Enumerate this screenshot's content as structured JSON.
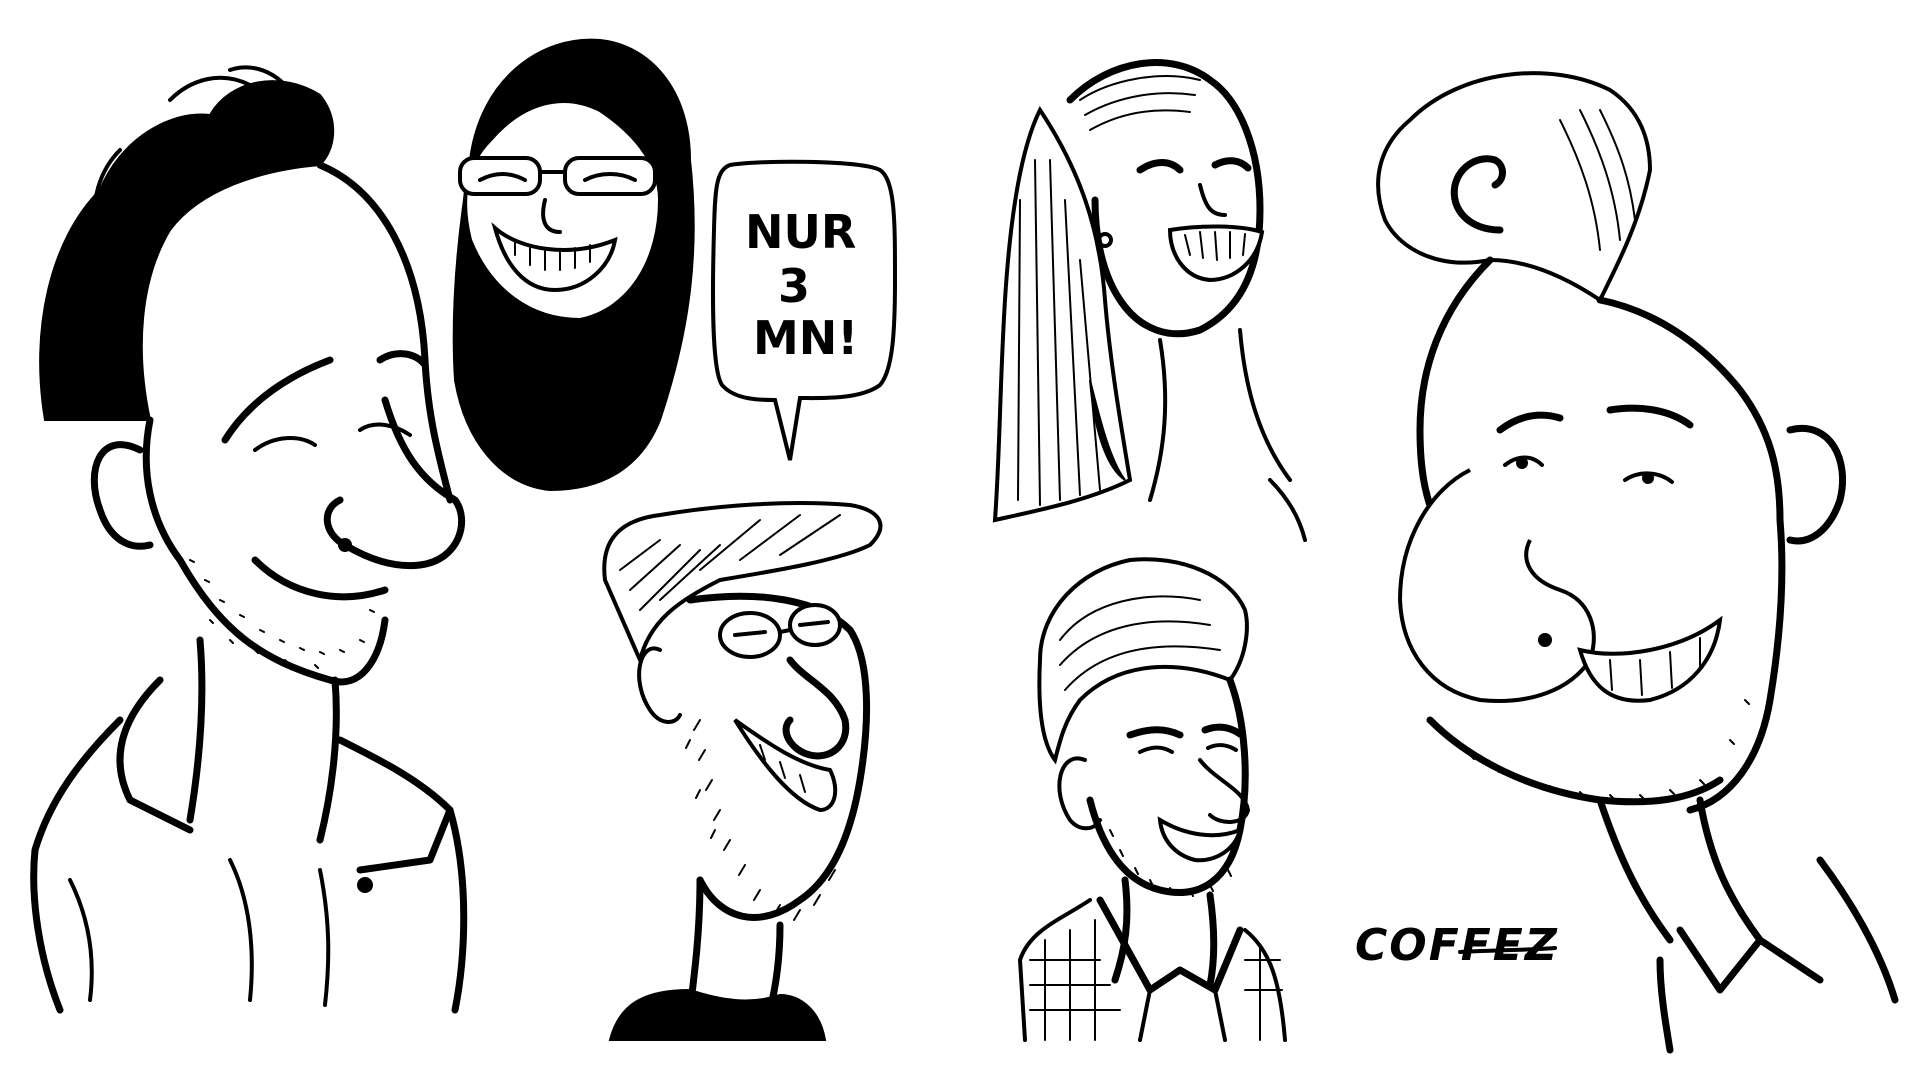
{
  "speech_bubble": {
    "lines": [
      "NUR",
      "3",
      "MN!"
    ]
  },
  "signature": {
    "text": "COFFEZ"
  },
  "caricatures": [
    {
      "id": "man-stubble-shirt"
    },
    {
      "id": "woman-long-hair-glasses"
    },
    {
      "id": "man-cap-glasses-beard"
    },
    {
      "id": "woman-ponytail-laughing"
    },
    {
      "id": "man-slicked-hair-blazer"
    },
    {
      "id": "man-curl-hair-big-nose"
    }
  ],
  "colors": {
    "ink": "#000000",
    "paper": "#ffffff"
  }
}
